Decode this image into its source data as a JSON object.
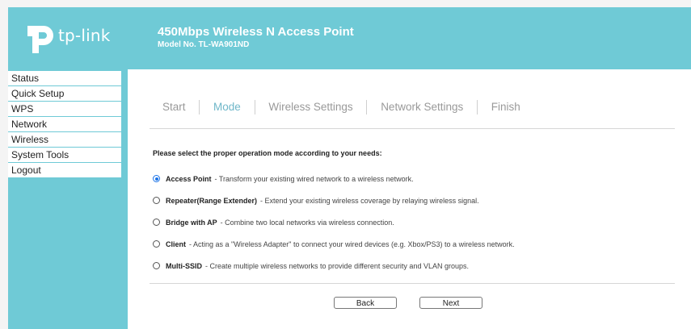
{
  "header": {
    "logo_text": "tp-link",
    "product_title": "450Mbps Wireless N Access Point",
    "model_no": "Model No. TL-WA901ND",
    "accent_color": "#6fcad6"
  },
  "sidebar": {
    "items": [
      {
        "label": "Status"
      },
      {
        "label": "Quick Setup"
      },
      {
        "label": "WPS"
      },
      {
        "label": "Network"
      },
      {
        "label": "Wireless"
      },
      {
        "label": "System Tools"
      },
      {
        "label": "Logout"
      }
    ]
  },
  "wizard": {
    "steps": [
      {
        "label": "Start",
        "active": false
      },
      {
        "label": "Mode",
        "active": true
      },
      {
        "label": "Wireless Settings",
        "active": false
      },
      {
        "label": "Network Settings",
        "active": false
      },
      {
        "label": "Finish",
        "active": false
      }
    ],
    "active_color": "#6fb7c9"
  },
  "mode": {
    "prompt": "Please select the proper operation mode according to your needs:",
    "options": [
      {
        "name": "Access Point",
        "desc": "- Transform your existing wired network to a wireless network.",
        "checked": true
      },
      {
        "name": "Repeater(Range Extender)",
        "desc": "- Extend your existing wireless coverage by relaying wireless signal.",
        "checked": false
      },
      {
        "name": "Bridge with AP",
        "desc": "- Combine two local networks via wireless connection.",
        "checked": false
      },
      {
        "name": "Client",
        "desc": "- Acting as a \"Wireless Adapter\" to connect your wired devices (e.g. Xbox/PS3) to a wireless network.",
        "checked": false
      },
      {
        "name": "Multi-SSID",
        "desc": "- Create multiple wireless networks to provide different security and VLAN groups.",
        "checked": false
      }
    ]
  },
  "buttons": {
    "back_label": "Back",
    "next_label": "Next"
  }
}
